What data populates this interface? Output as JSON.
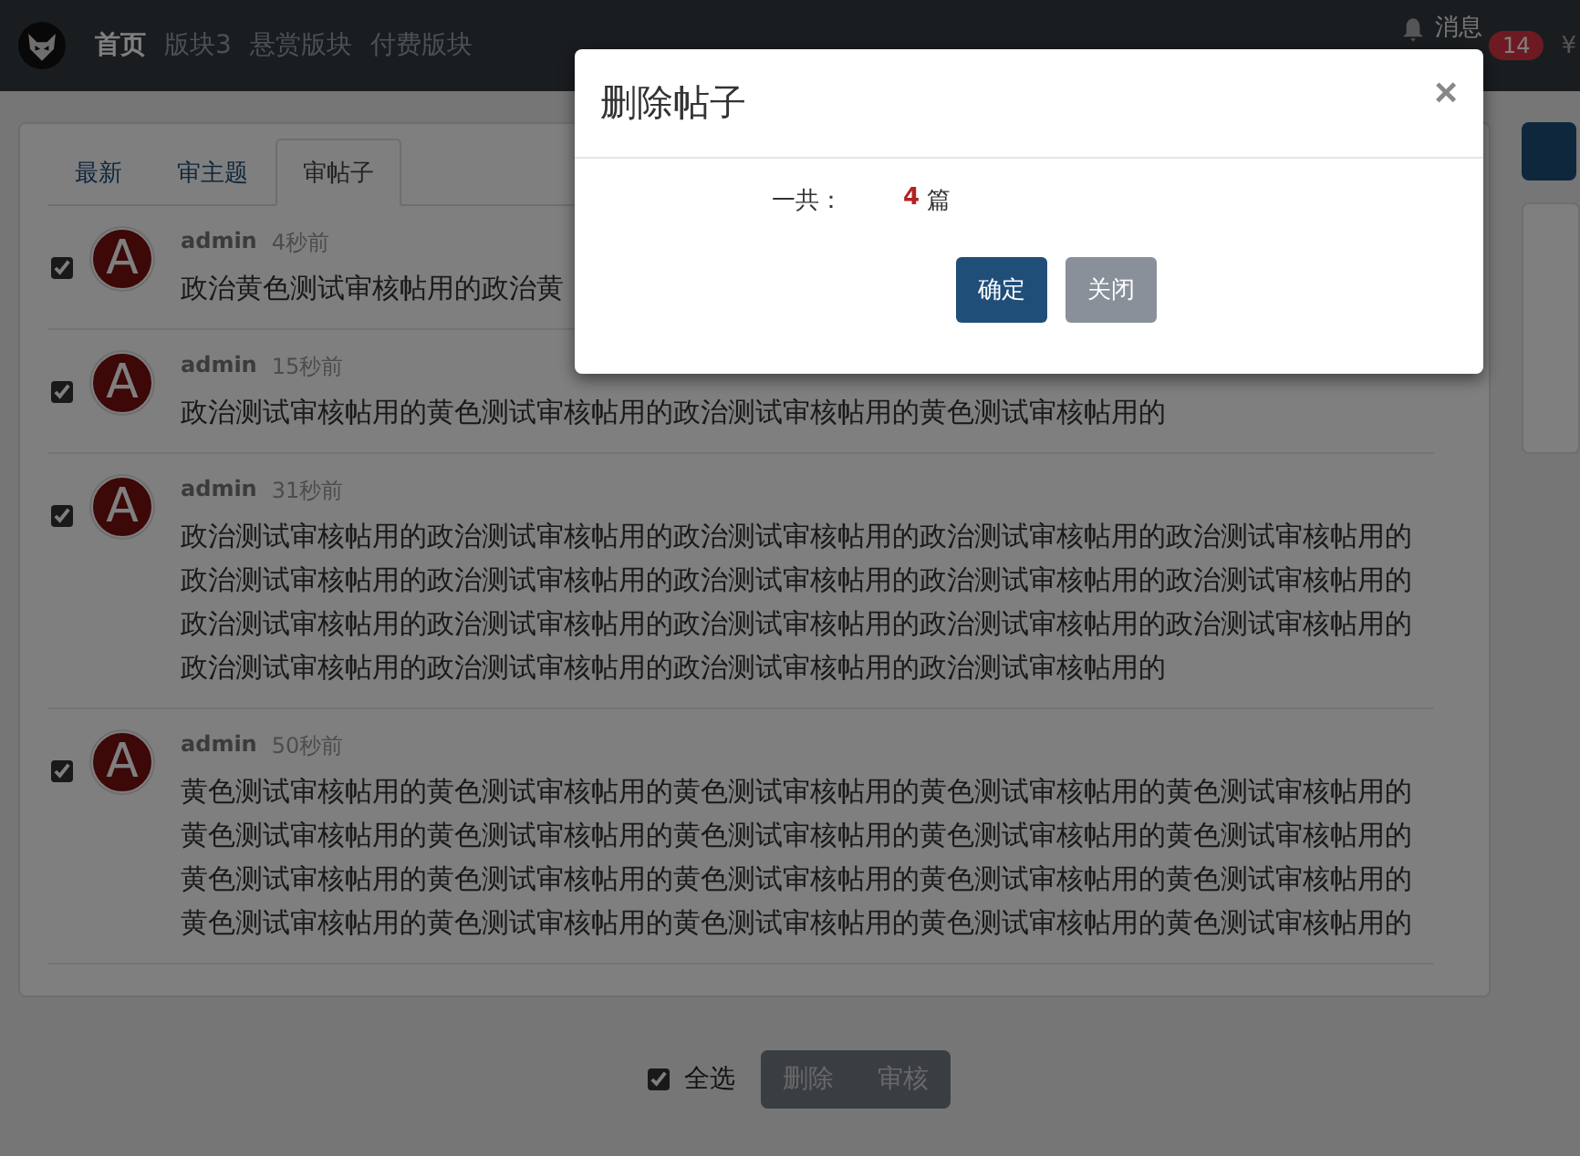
{
  "navbar": {
    "links": [
      {
        "label": "首页",
        "selected": true
      },
      {
        "label": "版块3",
        "selected": false
      },
      {
        "label": "悬赏版块",
        "selected": false
      },
      {
        "label": "付费版块",
        "selected": false
      }
    ],
    "messages": {
      "label": "消息",
      "count": "14"
    },
    "currency": "¥"
  },
  "tabs": [
    {
      "label": "最新",
      "selected": false
    },
    {
      "label": "审主题",
      "selected": false
    },
    {
      "label": "审帖子",
      "selected": true
    }
  ],
  "posts": [
    {
      "checked": true,
      "avatar_letter": "A",
      "author": "admin",
      "time": "4秒前",
      "text": "政治黄色测试审核帖用的政治黄"
    },
    {
      "checked": true,
      "avatar_letter": "A",
      "author": "admin",
      "time": "15秒前",
      "text": "政治测试审核帖用的黄色测试审核帖用的政治测试审核帖用的黄色测试审核帖用的"
    },
    {
      "checked": true,
      "avatar_letter": "A",
      "author": "admin",
      "time": "31秒前",
      "text": "政治测试审核帖用的政治测试审核帖用的政治测试审核帖用的政治测试审核帖用的政治测试审核帖用的政治测试审核帖用的政治测试审核帖用的政治测试审核帖用的政治测试审核帖用的政治测试审核帖用的政治测试审核帖用的政治测试审核帖用的政治测试审核帖用的政治测试审核帖用的政治测试审核帖用的政治测试审核帖用的政治测试审核帖用的政治测试审核帖用的政治测试审核帖用的"
    },
    {
      "checked": true,
      "avatar_letter": "A",
      "author": "admin",
      "time": "50秒前",
      "text": "黄色测试审核帖用的黄色测试审核帖用的黄色测试审核帖用的黄色测试审核帖用的黄色测试审核帖用的黄色测试审核帖用的黄色测试审核帖用的黄色测试审核帖用的黄色测试审核帖用的黄色测试审核帖用的黄色测试审核帖用的黄色测试审核帖用的黄色测试审核帖用的黄色测试审核帖用的黄色测试审核帖用的黄色测试审核帖用的黄色测试审核帖用的黄色测试审核帖用的黄色测试审核帖用的黄色测试审核帖用的"
    }
  ],
  "footer": {
    "select_all": {
      "label": "全选",
      "checked": true
    },
    "buttons": [
      "删除",
      "审核"
    ]
  },
  "modal": {
    "title": "删除帖子",
    "close": "×",
    "total_label": "一共：",
    "count": "4",
    "unit": "篇",
    "buttons": [
      {
        "label": "确定",
        "kind": "primary"
      },
      {
        "label": "关闭",
        "kind": "secondary"
      }
    ]
  }
}
